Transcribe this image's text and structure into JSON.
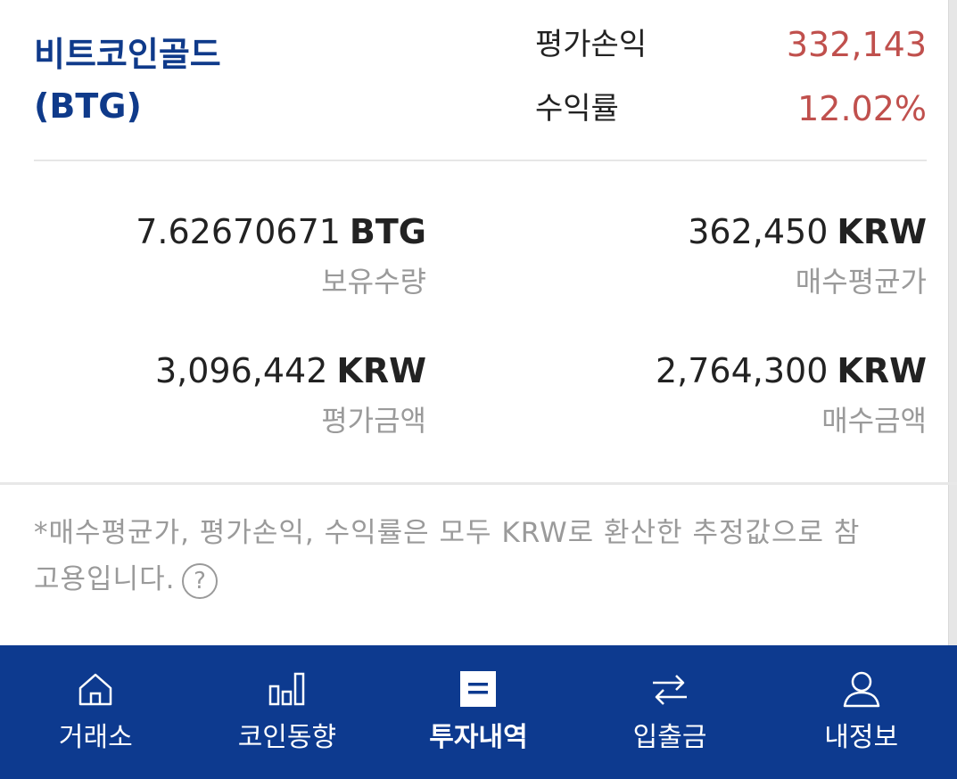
{
  "asset": {
    "name": "비트코인골드",
    "symbol": "(BTG)"
  },
  "summary": {
    "profit_label": "평가손익",
    "profit_value": "332,143",
    "rate_label": "수익률",
    "rate_value": "12.02%"
  },
  "metrics": {
    "holding_value": "7.62670671",
    "holding_unit": "BTG",
    "holding_label": "보유수량",
    "avg_price_value": "362,450",
    "avg_price_unit": "KRW",
    "avg_price_label": "매수평균가",
    "eval_amount_value": "3,096,442",
    "eval_amount_unit": "KRW",
    "eval_amount_label": "평가금액",
    "buy_amount_value": "2,764,300",
    "buy_amount_unit": "KRW",
    "buy_amount_label": "매수금액"
  },
  "note": {
    "text": "*매수평균가, 평가손익, 수익률은 모두 KRW로 환산한 추정값으로 참고용입니다.",
    "help_icon": "?"
  },
  "tabs": [
    {
      "label": "거래소",
      "icon": "home-icon"
    },
    {
      "label": "코인동향",
      "icon": "bar-chart-icon"
    },
    {
      "label": "투자내역",
      "icon": "document-icon",
      "active": true
    },
    {
      "label": "입출금",
      "icon": "transfer-icon"
    },
    {
      "label": "내정보",
      "icon": "user-icon"
    }
  ],
  "colors": {
    "brand": "#0d3a8f",
    "title": "#0f3a8a",
    "positive": "#c0504d",
    "muted": "#9a9a9a"
  }
}
